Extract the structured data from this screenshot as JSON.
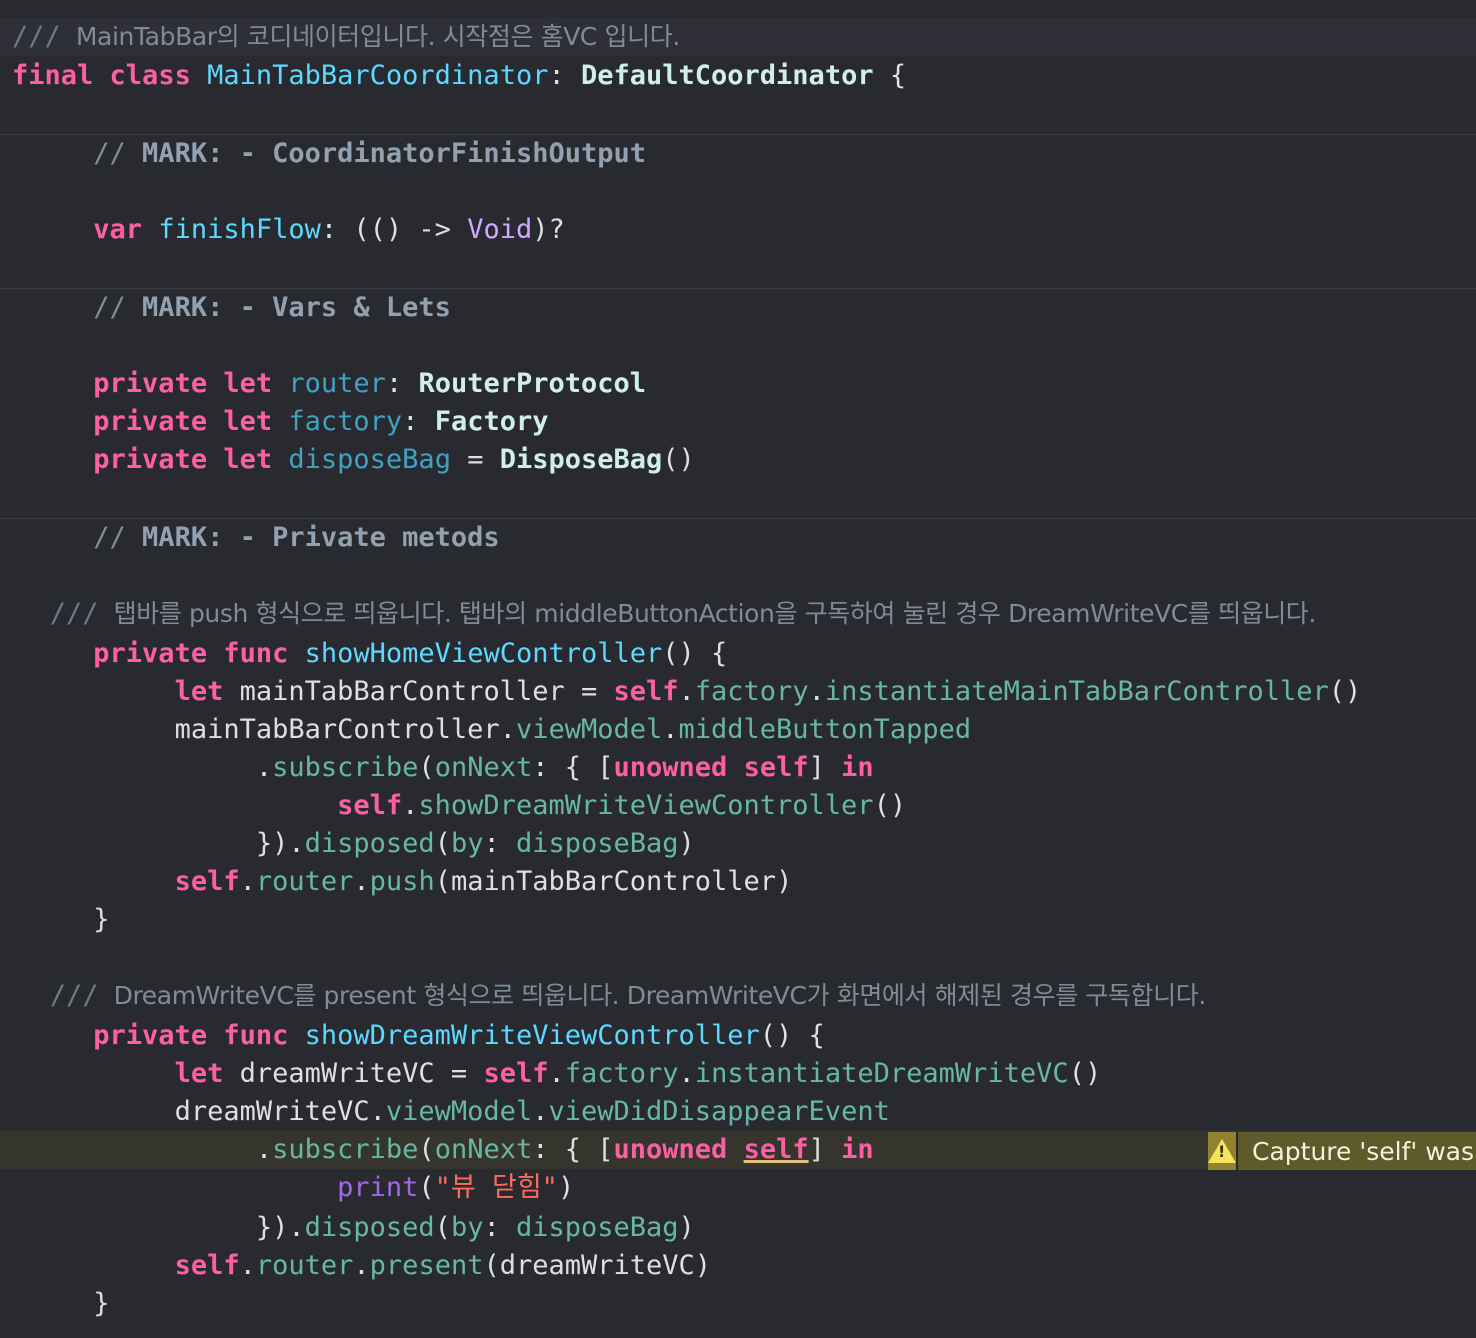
{
  "doc_comments": {
    "coordinator": "MainTabBar의 코디네이터입니다. 시작점은 홈VC 입니다.",
    "show_home": "탭바를 push 형식으로 띄웁니다. 탭바의 middleButtonAction을 구독하여 눌린 경우 DreamWriteVC를 띄웁니다.",
    "show_dream_write": "DreamWriteVC를 present 형식으로 띄웁니다. DreamWriteVC가 화면에서 해제된 경우를 구독합니다."
  },
  "class_decl": {
    "name": "MainTabBarCoordinator",
    "superclass": "DefaultCoordinator"
  },
  "marks": {
    "finish_output": "CoordinatorFinishOutput",
    "vars_lets": "Vars & Lets",
    "private_methods": "Private metods"
  },
  "properties": {
    "finish_flow": "finishFlow",
    "router": "router",
    "router_type": "RouterProtocol",
    "factory": "factory",
    "factory_type": "Factory",
    "dispose_bag": "disposeBag",
    "dispose_bag_type": "DisposeBag"
  },
  "functions": {
    "show_home": "showHomeViewController",
    "show_dream_write": "showDreamWriteViewController"
  },
  "string_literal": "\"뷰 닫힘\"",
  "warning": {
    "message": "Capture 'self' was never used",
    "icon": "warning-triangle-icon",
    "color": "#8f8230"
  },
  "colors": {
    "background": "#292a30",
    "keyword": "#fc5fa3",
    "declaration": "#5dd8ff",
    "string": "#fc6a5d"
  }
}
